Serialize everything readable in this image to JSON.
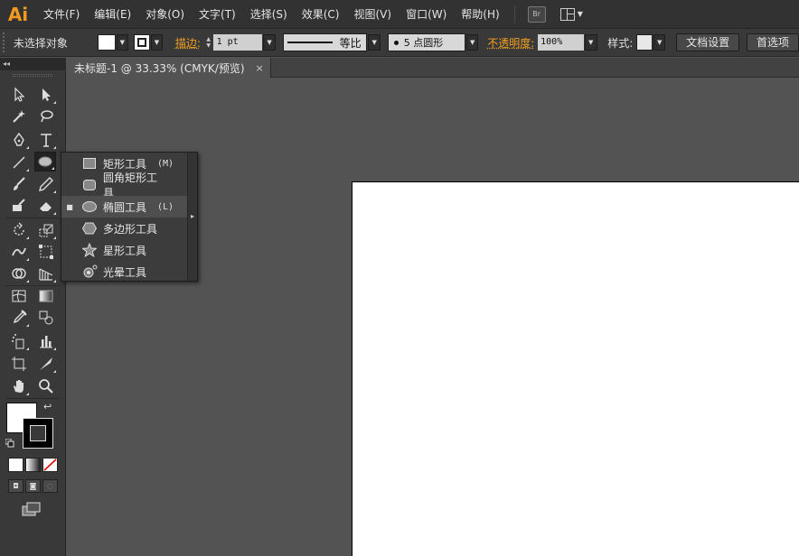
{
  "app": {
    "logo": "Ai"
  },
  "menu": {
    "items": [
      "文件(F)",
      "编辑(E)",
      "对象(O)",
      "文字(T)",
      "选择(S)",
      "效果(C)",
      "视图(V)",
      "窗口(W)",
      "帮助(H)"
    ],
    "bridge_label": "Br"
  },
  "control_bar": {
    "selection_status": "未选择对象",
    "stroke_label": "描边:",
    "stroke_value": "1 pt",
    "stroke_profile": "等比",
    "brush": "5 点圆形",
    "opacity_label": "不透明度:",
    "opacity_value": "100%",
    "style_label": "样式:",
    "doc_setup": "文档设置",
    "preferences": "首选项"
  },
  "toolbar_header": "◂◂",
  "document": {
    "tab_title": "未标题-1 @ 33.33% (CMYK/预览)",
    "close_glyph": "×"
  },
  "flyout": {
    "tear_glyph": "▸",
    "selected_bullet": "■",
    "items": [
      {
        "label": "矩形工具",
        "shortcut": "(M)",
        "icon": "rectangle-icon"
      },
      {
        "label": "圆角矩形工具",
        "shortcut": "",
        "icon": "rounded-rectangle-icon"
      },
      {
        "label": "椭圆工具",
        "shortcut": "(L)",
        "icon": "ellipse-icon"
      },
      {
        "label": "多边形工具",
        "shortcut": "",
        "icon": "polygon-icon"
      },
      {
        "label": "星形工具",
        "shortcut": "",
        "icon": "star-icon"
      },
      {
        "label": "光晕工具",
        "shortcut": "",
        "icon": "flare-icon"
      }
    ],
    "selected_index": 2
  },
  "colors": {
    "accent_orange": "#f29a1f",
    "chrome_dark": "#323232",
    "panel": "#393939",
    "canvas": "#535353",
    "artboard": "#ffffff"
  }
}
